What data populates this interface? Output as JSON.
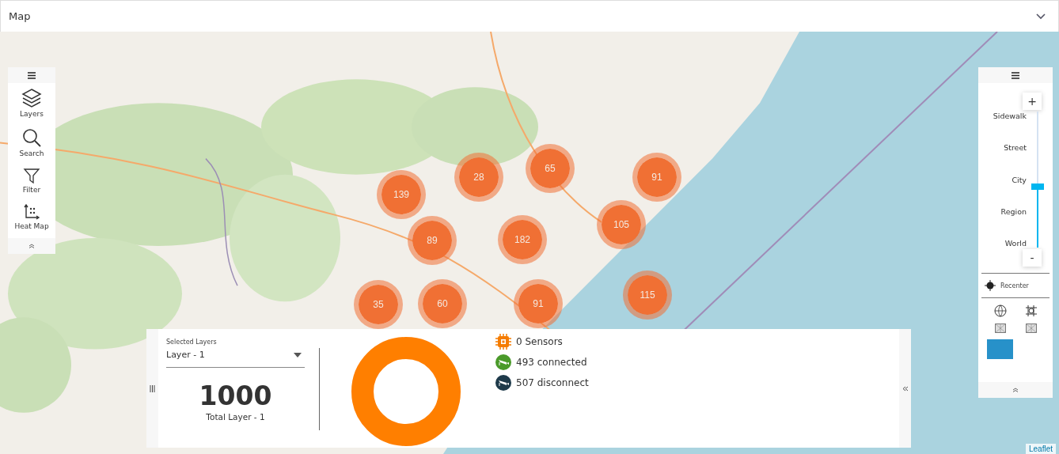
{
  "header": {
    "title": "Map"
  },
  "toolbar": {
    "items": [
      {
        "kind": "layers",
        "label": "Layers"
      },
      {
        "kind": "search",
        "label": "Search"
      },
      {
        "kind": "filter",
        "label": "Filter"
      },
      {
        "kind": "heatmap",
        "label": "Heat Map"
      }
    ]
  },
  "clusters": [
    {
      "count": "139"
    },
    {
      "count": "28"
    },
    {
      "count": "65"
    },
    {
      "count": "91"
    },
    {
      "count": "105"
    },
    {
      "count": "89"
    },
    {
      "count": "182"
    },
    {
      "count": "115"
    },
    {
      "count": "35"
    },
    {
      "count": "60"
    },
    {
      "count": "91"
    }
  ],
  "zoom_panel": {
    "zoom_in": "+",
    "zoom_out": "-",
    "stops": [
      "Sidewalk",
      "Street",
      "City",
      "Region",
      "World"
    ],
    "level": 0.45,
    "recenter": "Recenter"
  },
  "summary": {
    "selected_label": "Selected Layers",
    "layer": "Layer - 1",
    "total": "1000",
    "total_label": "Total Layer - 1",
    "legend": [
      {
        "kind": "sensor",
        "text": "0 Sensors",
        "color": "#f57c00"
      },
      {
        "kind": "camera",
        "text": "493 connected",
        "color": "#4a9a2a"
      },
      {
        "kind": "camera",
        "text": "507 disconnect",
        "color": "#1e3a4a"
      }
    ]
  },
  "attribution": "Leaflet"
}
